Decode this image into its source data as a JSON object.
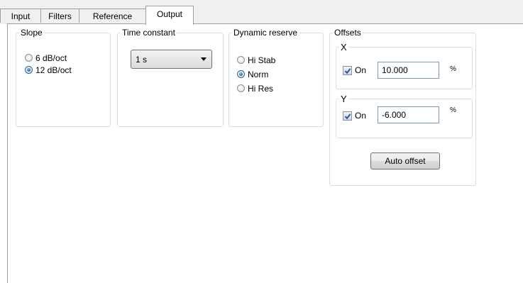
{
  "tabs": [
    {
      "label": "Input",
      "active": false
    },
    {
      "label": "Filters",
      "active": false
    },
    {
      "label": "Reference",
      "active": false
    },
    {
      "label": "Output",
      "active": true
    }
  ],
  "slope": {
    "title": "Slope",
    "options": [
      {
        "label": "6 dB/oct",
        "checked": false
      },
      {
        "label": "12 dB/oct",
        "checked": true
      }
    ]
  },
  "time_constant": {
    "title": "Time constant",
    "selected": "1 s"
  },
  "dynamic_reserve": {
    "title": "Dynamic reserve",
    "options": [
      {
        "label": "Hi Stab",
        "checked": false
      },
      {
        "label": "Norm",
        "checked": true
      },
      {
        "label": "Hi Res",
        "checked": false
      }
    ]
  },
  "offsets": {
    "title": "Offsets",
    "x": {
      "title": "X",
      "on_label": "On",
      "on_checked": true,
      "value": "10.000",
      "unit": "%"
    },
    "y": {
      "title": "Y",
      "on_label": "On",
      "on_checked": true,
      "value": "-6.000",
      "unit": "%"
    },
    "auto_offset_label": "Auto offset"
  },
  "colors": {
    "check_mark": "#1c4f9c",
    "radio_dot": "#1c5da8",
    "group_border": "#d5dfe5"
  }
}
